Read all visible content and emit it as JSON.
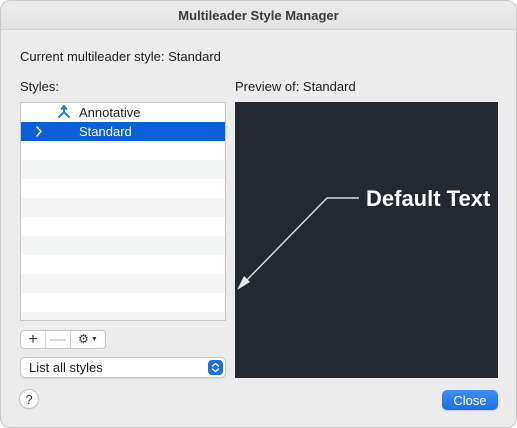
{
  "window": {
    "title": "Multileader Style Manager"
  },
  "current_style": {
    "text": "Current multileader style: Standard"
  },
  "styles_panel": {
    "label": "Styles:",
    "items": [
      {
        "label": "Annotative",
        "icon": "annotative-icon",
        "selected": false
      },
      {
        "label": "Standard",
        "icon": "",
        "selected": true,
        "expandable": true
      }
    ],
    "filter": {
      "value": "List all styles"
    }
  },
  "toolbar": {
    "add": "+",
    "remove": "—",
    "options": "⚙"
  },
  "preview": {
    "label": "Preview of: Standard",
    "sample_text": "Default Text",
    "background": "#222931"
  },
  "footer": {
    "help": "?",
    "close": "Close"
  },
  "colors": {
    "accent": "#0a60d8",
    "button": "#1f6fe6",
    "annotative_icon": "#2a82d6"
  }
}
